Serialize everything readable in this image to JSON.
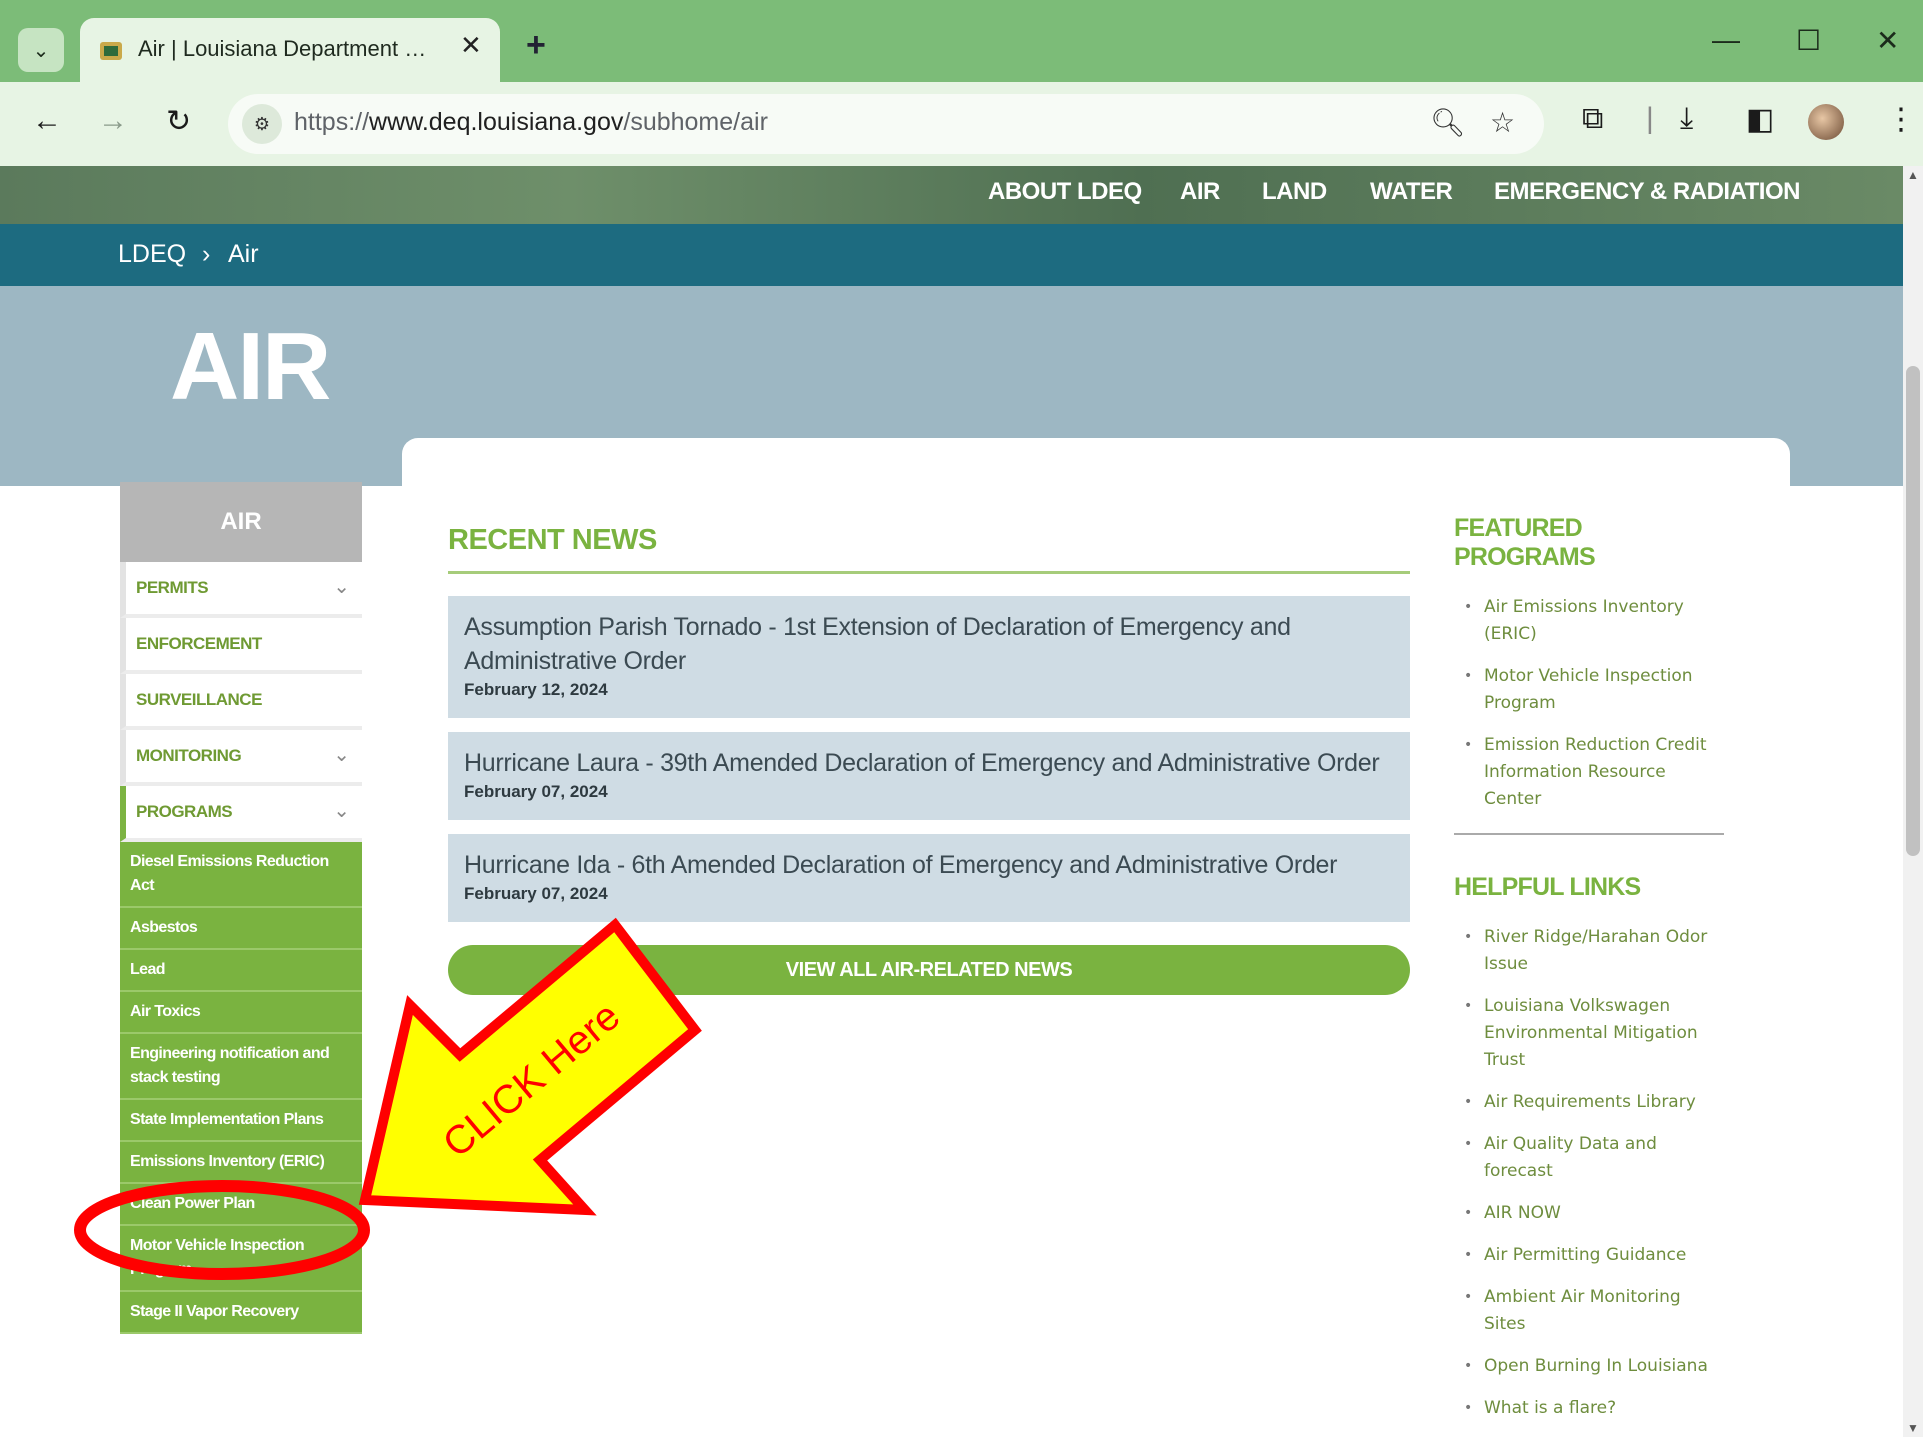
{
  "browser": {
    "tab_title": "Air | Louisiana Department of Environmental Quality",
    "url_prefix": "https://",
    "url_main": "www.deq.louisiana.gov",
    "url_path": "/subhome/air",
    "icons": [
      "chevron-down-icon",
      "favicon-icon",
      "close-icon",
      "plus-icon",
      "minimize-icon",
      "maximize-icon",
      "close-window-icon",
      "back-icon",
      "forward-icon",
      "reload-icon",
      "site-info-icon",
      "zoom-icon",
      "star-icon",
      "extensions-icon",
      "download-icon",
      "sidepanel-icon",
      "avatar",
      "menu-icon"
    ]
  },
  "top_nav": {
    "items": [
      "ABOUT LDEQ",
      "AIR",
      "LAND",
      "WATER",
      "EMERGENCY & RADIATION"
    ]
  },
  "breadcrumb": {
    "home": "LDEQ",
    "sep": "›",
    "current": "Air"
  },
  "hero": {
    "title": "AIR"
  },
  "sidebar": {
    "title": "AIR",
    "items": [
      {
        "label": "PERMITS",
        "chevron": "⌄"
      },
      {
        "label": "ENFORCEMENT"
      },
      {
        "label": "SURVEILLANCE"
      },
      {
        "label": "MONITORING",
        "chevron": "⌄"
      },
      {
        "label": "PROGRAMS",
        "chevron": "⌄"
      }
    ],
    "programs": [
      "Diesel Emissions Reduction Act",
      "Asbestos",
      "Lead",
      "Air Toxics",
      "Engineering notification and stack testing",
      "State Implementation Plans",
      "Emissions Inventory (ERIC)",
      "Clean Power Plan",
      "Motor Vehicle Inspection Program",
      "Stage II Vapor Recovery"
    ]
  },
  "news": {
    "heading": "RECENT NEWS",
    "items": [
      {
        "title": "Assumption Parish Tornado - 1st Extension of Declaration of Emergency and Administrative Order",
        "date": "February 12, 2024"
      },
      {
        "title": "Hurricane Laura - 39th Amended Declaration of Emergency and Administrative Order",
        "date": "February 07, 2024"
      },
      {
        "title": "Hurricane Ida - 6th Amended Declaration of Emergency and Administrative Order",
        "date": "February 07, 2024"
      }
    ],
    "view_all": "VIEW ALL AIR-RELATED NEWS"
  },
  "featured": {
    "heading": "FEATURED PROGRAMS",
    "items": [
      "Air Emissions Inventory (ERIC)",
      "Motor Vehicle Inspection Program",
      "Emission Reduction Credit Information Resource Center"
    ]
  },
  "helpful": {
    "heading": "HELPFUL LINKS",
    "items": [
      "River Ridge/Harahan Odor Issue",
      "Louisiana Volkswagen Environmental Mitigation Trust",
      "Air Requirements Library",
      "Air Quality Data and forecast",
      "AIR NOW",
      "Air Permitting Guidance",
      "Ambient Air Monitoring Sites",
      "Open Burning In Louisiana",
      "What is a flare?"
    ]
  },
  "annotation": {
    "text": "CLICK Here",
    "arrow_fill": "#ffff00",
    "stroke": "#ff0000"
  }
}
